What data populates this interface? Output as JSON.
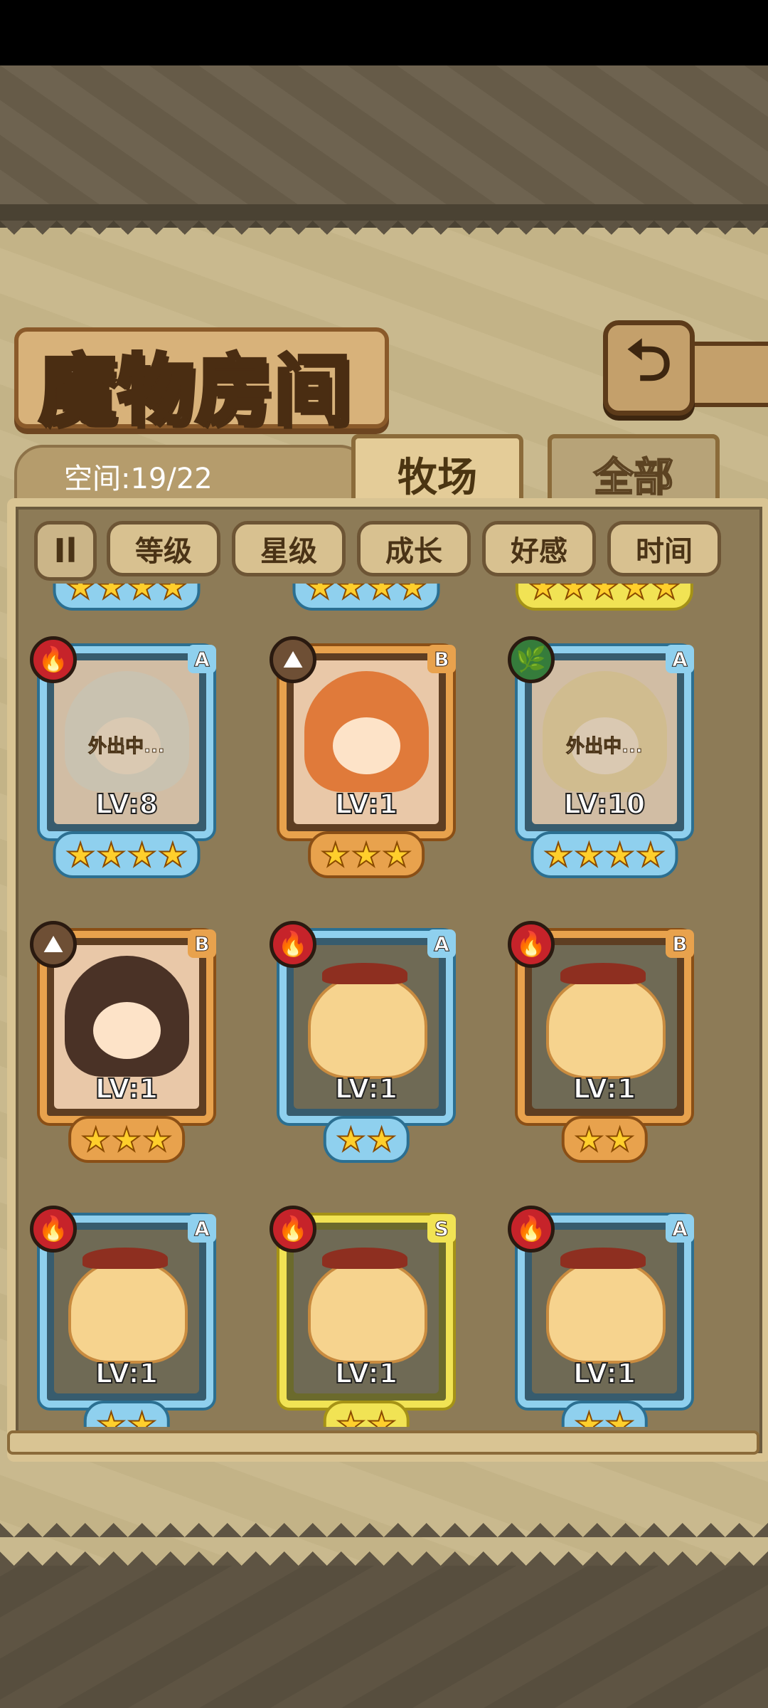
{
  "header": {
    "title": "魔物房间",
    "back_icon": "back-arrow-icon"
  },
  "capacity": {
    "label": "空间:19/22"
  },
  "tabs": [
    {
      "label": "牧场",
      "active": true
    },
    {
      "label": "全部",
      "active": false
    }
  ],
  "sort": {
    "toggle_glyph": "Il",
    "buttons": [
      {
        "label": "等级"
      },
      {
        "label": "星级"
      },
      {
        "label": "成长"
      },
      {
        "label": "好感"
      },
      {
        "label": "时间"
      }
    ]
  },
  "monsters": [
    {
      "element": "fire",
      "rank": "A",
      "frame": "blue",
      "level": "LV:8",
      "stars": 4,
      "status": "外出中...",
      "portrait": "girl-white"
    },
    {
      "element": "earth",
      "rank": "B",
      "frame": "orange",
      "level": "LV:1",
      "stars": 3,
      "status": "",
      "portrait": "girl-orange"
    },
    {
      "element": "wood",
      "rank": "A",
      "frame": "blue",
      "level": "LV:10",
      "stars": 4,
      "status": "外出中...",
      "portrait": "girl-blonde"
    },
    {
      "element": "earth",
      "rank": "B",
      "frame": "orange",
      "level": "LV:1",
      "stars": 3,
      "status": "",
      "portrait": "girl-brown"
    },
    {
      "element": "fire",
      "rank": "A",
      "frame": "blue",
      "level": "LV:1",
      "stars": 2,
      "status": "",
      "portrait": "pudding"
    },
    {
      "element": "fire",
      "rank": "B",
      "frame": "orange",
      "level": "LV:1",
      "stars": 2,
      "status": "",
      "portrait": "pudding"
    },
    {
      "element": "fire",
      "rank": "A",
      "frame": "blue",
      "level": "LV:1",
      "stars": 2,
      "status": "",
      "portrait": "pudding"
    },
    {
      "element": "fire",
      "rank": "S",
      "frame": "yellow",
      "level": "LV:1",
      "stars": 2,
      "status": "",
      "portrait": "pudding"
    },
    {
      "element": "fire",
      "rank": "A",
      "frame": "blue",
      "level": "LV:1",
      "stars": 2,
      "status": "",
      "portrait": "pudding"
    }
  ],
  "peek_row": [
    {
      "frame": "blue",
      "stars": 4
    },
    {
      "frame": "blue",
      "stars": 4
    },
    {
      "frame": "yellow",
      "stars": 5
    }
  ],
  "colors": {
    "fire": "#c6232a",
    "earth": "#6e4f35",
    "wood": "#357c3b",
    "frame_blue": "#8fd0ee",
    "frame_orange": "#e8a24d",
    "frame_yellow": "#f1e354"
  }
}
